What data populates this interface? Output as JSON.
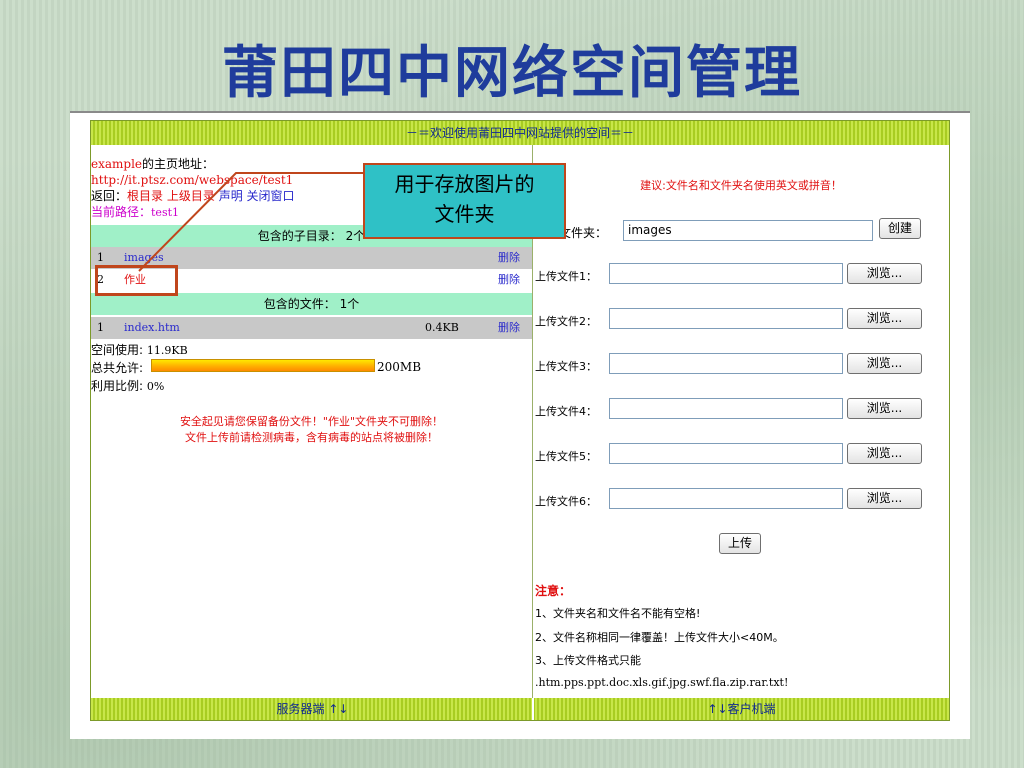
{
  "slide_title": "莆田四中网络空间管理",
  "header_bar": "－＝欢迎使用莆田四中网站提供的空间＝－",
  "footer": {
    "server": "服务器端 ↑↓",
    "client": "↑↓客户机端"
  },
  "left": {
    "homepage_prefix": "example",
    "homepage_label": "的主页地址：",
    "homepage_url": "http://it.ptsz.com/webspace/test1",
    "back_label": "返回：",
    "back_root": "根目录",
    "back_up": "上级目录",
    "back_statement": "声明",
    "back_close": "关闭窗口",
    "path_label": "当前路径：",
    "path_value": "test1",
    "subdirs_header": "包含的子目录： 2个",
    "subdirs": [
      {
        "num": "1",
        "name": "images",
        "delete": "删除"
      },
      {
        "num": "2",
        "name": "作业",
        "delete": "删除"
      }
    ],
    "files_header": "包含的文件： 1个",
    "files": [
      {
        "num": "1",
        "name": "index.htm",
        "size": "0.4KB",
        "delete": "删除"
      }
    ],
    "space_used_label": "空间使用:",
    "space_used_value": "11.9KB",
    "total_label": "总共允许:",
    "total_value": "200MB",
    "ratio_label": "利用比例:",
    "ratio_value": "0%",
    "warning_1": "安全起见请您保留备份文件！\"作业\"文件夹不可删除！",
    "warning_2": "文件上传前请检测病毒，含有病毒的站点将被删除！"
  },
  "callout": {
    "line1": "用于存放图片的",
    "line2": "文件夹"
  },
  "right": {
    "suggestion": "建议:文件名和文件夹名使用英文或拼音！",
    "new_folder_label": "新建文件夹：",
    "new_folder_value": "images",
    "create_button": "创建",
    "upload_rows": [
      {
        "label": "上传文件1：",
        "browse": "浏览..."
      },
      {
        "label": "上传文件2：",
        "browse": "浏览..."
      },
      {
        "label": "上传文件3：",
        "browse": "浏览..."
      },
      {
        "label": "上传文件4：",
        "browse": "浏览..."
      },
      {
        "label": "上传文件5：",
        "browse": "浏览..."
      },
      {
        "label": "上传文件6：",
        "browse": "浏览..."
      }
    ],
    "upload_button": "上传",
    "notes_title": "注意：",
    "notes": [
      "1、文件夹名和文件名不能有空格!",
      "2、文件名称相同一律覆盖！上传文件大小<40M。",
      "3、上传文件格式只能",
      ".htm.pps.ppt.doc.xls.gif.jpg.swf.fla.zip.rar.txt!"
    ]
  },
  "colors": {
    "title": "#1f3c9c",
    "header_bar": "#b4d630",
    "callout_fill": "#2fc1c6",
    "callout_border": "#c0461c",
    "green_row": "#a0f0c8",
    "gray_row": "#c8c8c8"
  }
}
